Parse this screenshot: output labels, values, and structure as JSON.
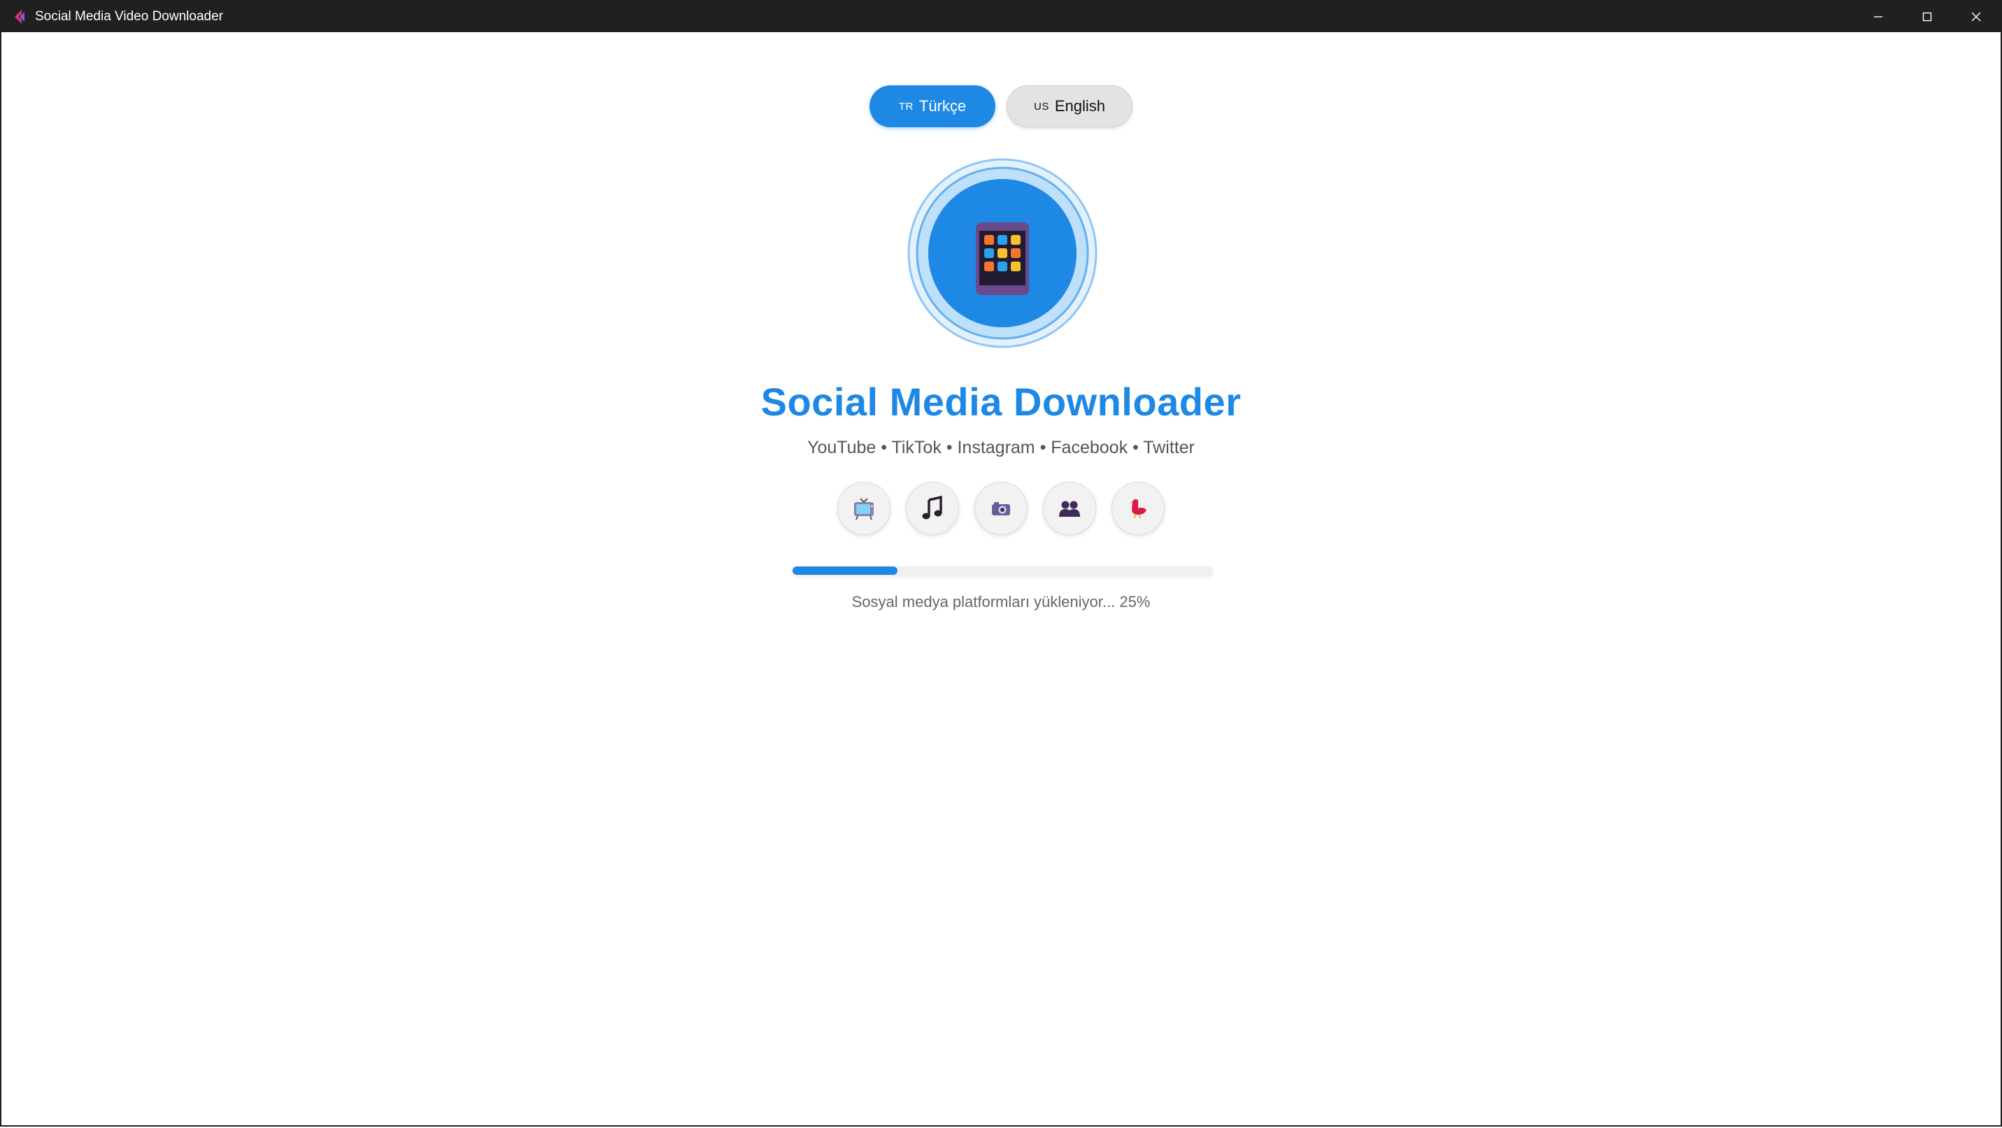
{
  "window": {
    "title": "Social Media Video Downloader",
    "app_icon": "back-arrow-icon"
  },
  "language": {
    "turkish": {
      "flag": "TR",
      "label": "Türkçe",
      "active": true
    },
    "english": {
      "flag": "US",
      "label": "English",
      "active": false
    }
  },
  "logo": {
    "icon": "phone-app-grid-icon"
  },
  "app": {
    "title": "Social Media Downloader",
    "platforms": "YouTube • TikTok • Instagram • Facebook • Twitter"
  },
  "platform_icons": [
    "tv-icon",
    "music-note-icon",
    "camera-icon",
    "people-icon",
    "bird-icon"
  ],
  "loading": {
    "progress": 25,
    "status": "Sosyal medya platformları yükleniyor... 25%"
  },
  "colors": {
    "accent": "#1e88e5",
    "titlebar": "#202020",
    "background": "#ffffff"
  }
}
